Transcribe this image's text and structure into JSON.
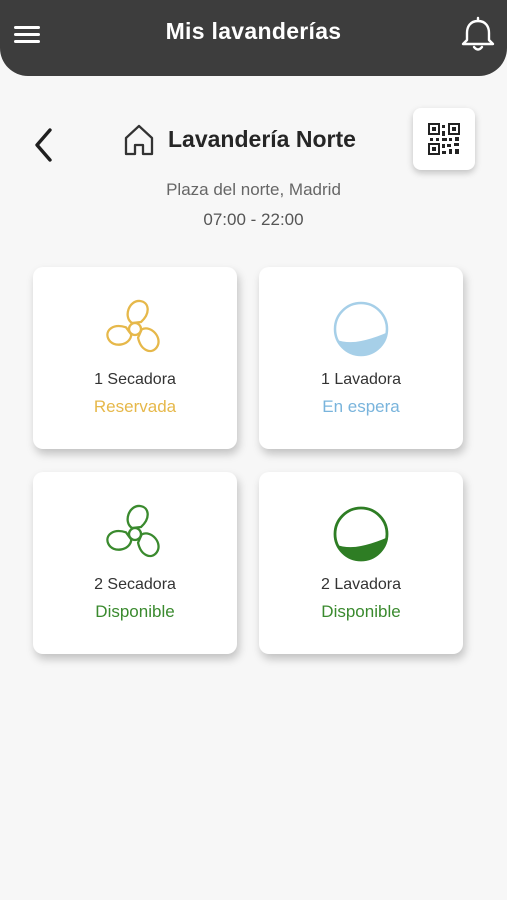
{
  "header": {
    "title": "Mis lavanderías",
    "menu_icon": "hamburger-menu-icon",
    "bell_icon": "bell-icon"
  },
  "store": {
    "name": "Lavandería Norte",
    "address": "Plaza del norte, Madrid",
    "hours": "07:00 - 22:00",
    "home_icon": "home-icon",
    "back_icon": "chevron-left-icon",
    "qr_icon": "qr-code-icon"
  },
  "colors": {
    "header_bg": "#3d3d3d",
    "reserved": "#e6b84a",
    "waiting": "#79b4dc",
    "available": "#3a8a2e"
  },
  "machines": [
    {
      "label": "1 Secadora",
      "status": "Reservada",
      "type": "dryer",
      "icon": "fan-icon"
    },
    {
      "label": "1 Lavadora",
      "status": "En espera",
      "type": "washer",
      "icon": "washer-drum-icon"
    },
    {
      "label": "2 Secadora",
      "status": "Disponible",
      "type": "dryer",
      "icon": "fan-icon"
    },
    {
      "label": "2 Lavadora",
      "status": "Disponible",
      "type": "washer",
      "icon": "washer-drum-icon"
    }
  ]
}
